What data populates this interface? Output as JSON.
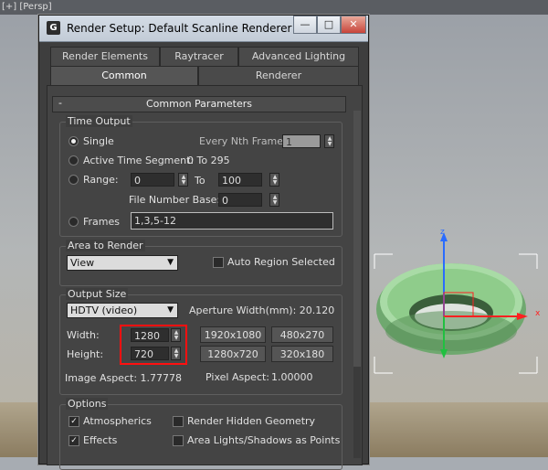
{
  "viewport": {
    "label": "[+] [Persp]"
  },
  "window": {
    "title": "Render Setup: Default Scanline Renderer",
    "app_icon": "G",
    "controls": {
      "minimize": "—",
      "maximize": "□",
      "close": "✕"
    }
  },
  "tabs": {
    "row1": [
      "Render Elements",
      "Raytracer",
      "Advanced Lighting"
    ],
    "row2": [
      "Common",
      "Renderer"
    ]
  },
  "rollout": {
    "toggle": "-",
    "title": "Common Parameters"
  },
  "time_output": {
    "title": "Time Output",
    "single": "Single",
    "every_nth_label": "Every Nth Frame:",
    "every_nth_value": "1",
    "active_segment": "Active Time Segment:",
    "active_segment_value": "0 To 295",
    "range": "Range:",
    "range_from": "0",
    "to_label": "To",
    "range_to": "100",
    "file_base_label": "File Number Base:",
    "file_base_value": "0",
    "frames": "Frames",
    "frames_value": "1,3,5-12"
  },
  "area_to_render": {
    "title": "Area to Render",
    "selected": "View",
    "auto_region": "Auto Region Selected"
  },
  "output_size": {
    "title": "Output Size",
    "preset": "HDTV (video)",
    "aperture_label": "Aperture Width(mm): 20.120",
    "width_label": "Width:",
    "width_value": "1280",
    "height_label": "Height:",
    "height_value": "720",
    "presets": [
      "1920x1080",
      "480x270",
      "1280x720",
      "320x180"
    ],
    "image_aspect": "Image Aspect: 1.77778",
    "pixel_aspect_label": "Pixel Aspect:",
    "pixel_aspect_value": "1.00000"
  },
  "options": {
    "title": "Options",
    "atmospherics": "Atmospherics",
    "render_hidden": "Render Hidden Geometry",
    "effects": "Effects",
    "area_lights": "Area Lights/Shadows as Points"
  },
  "gizmo": {
    "z": "z",
    "x": "x"
  },
  "colors": {
    "highlight": "#ff1010",
    "torus": "#7fbf7f",
    "gizmo_z": "#2a6cff",
    "gizmo_x": "#ff2020",
    "gizmo_y": "#20c040"
  }
}
